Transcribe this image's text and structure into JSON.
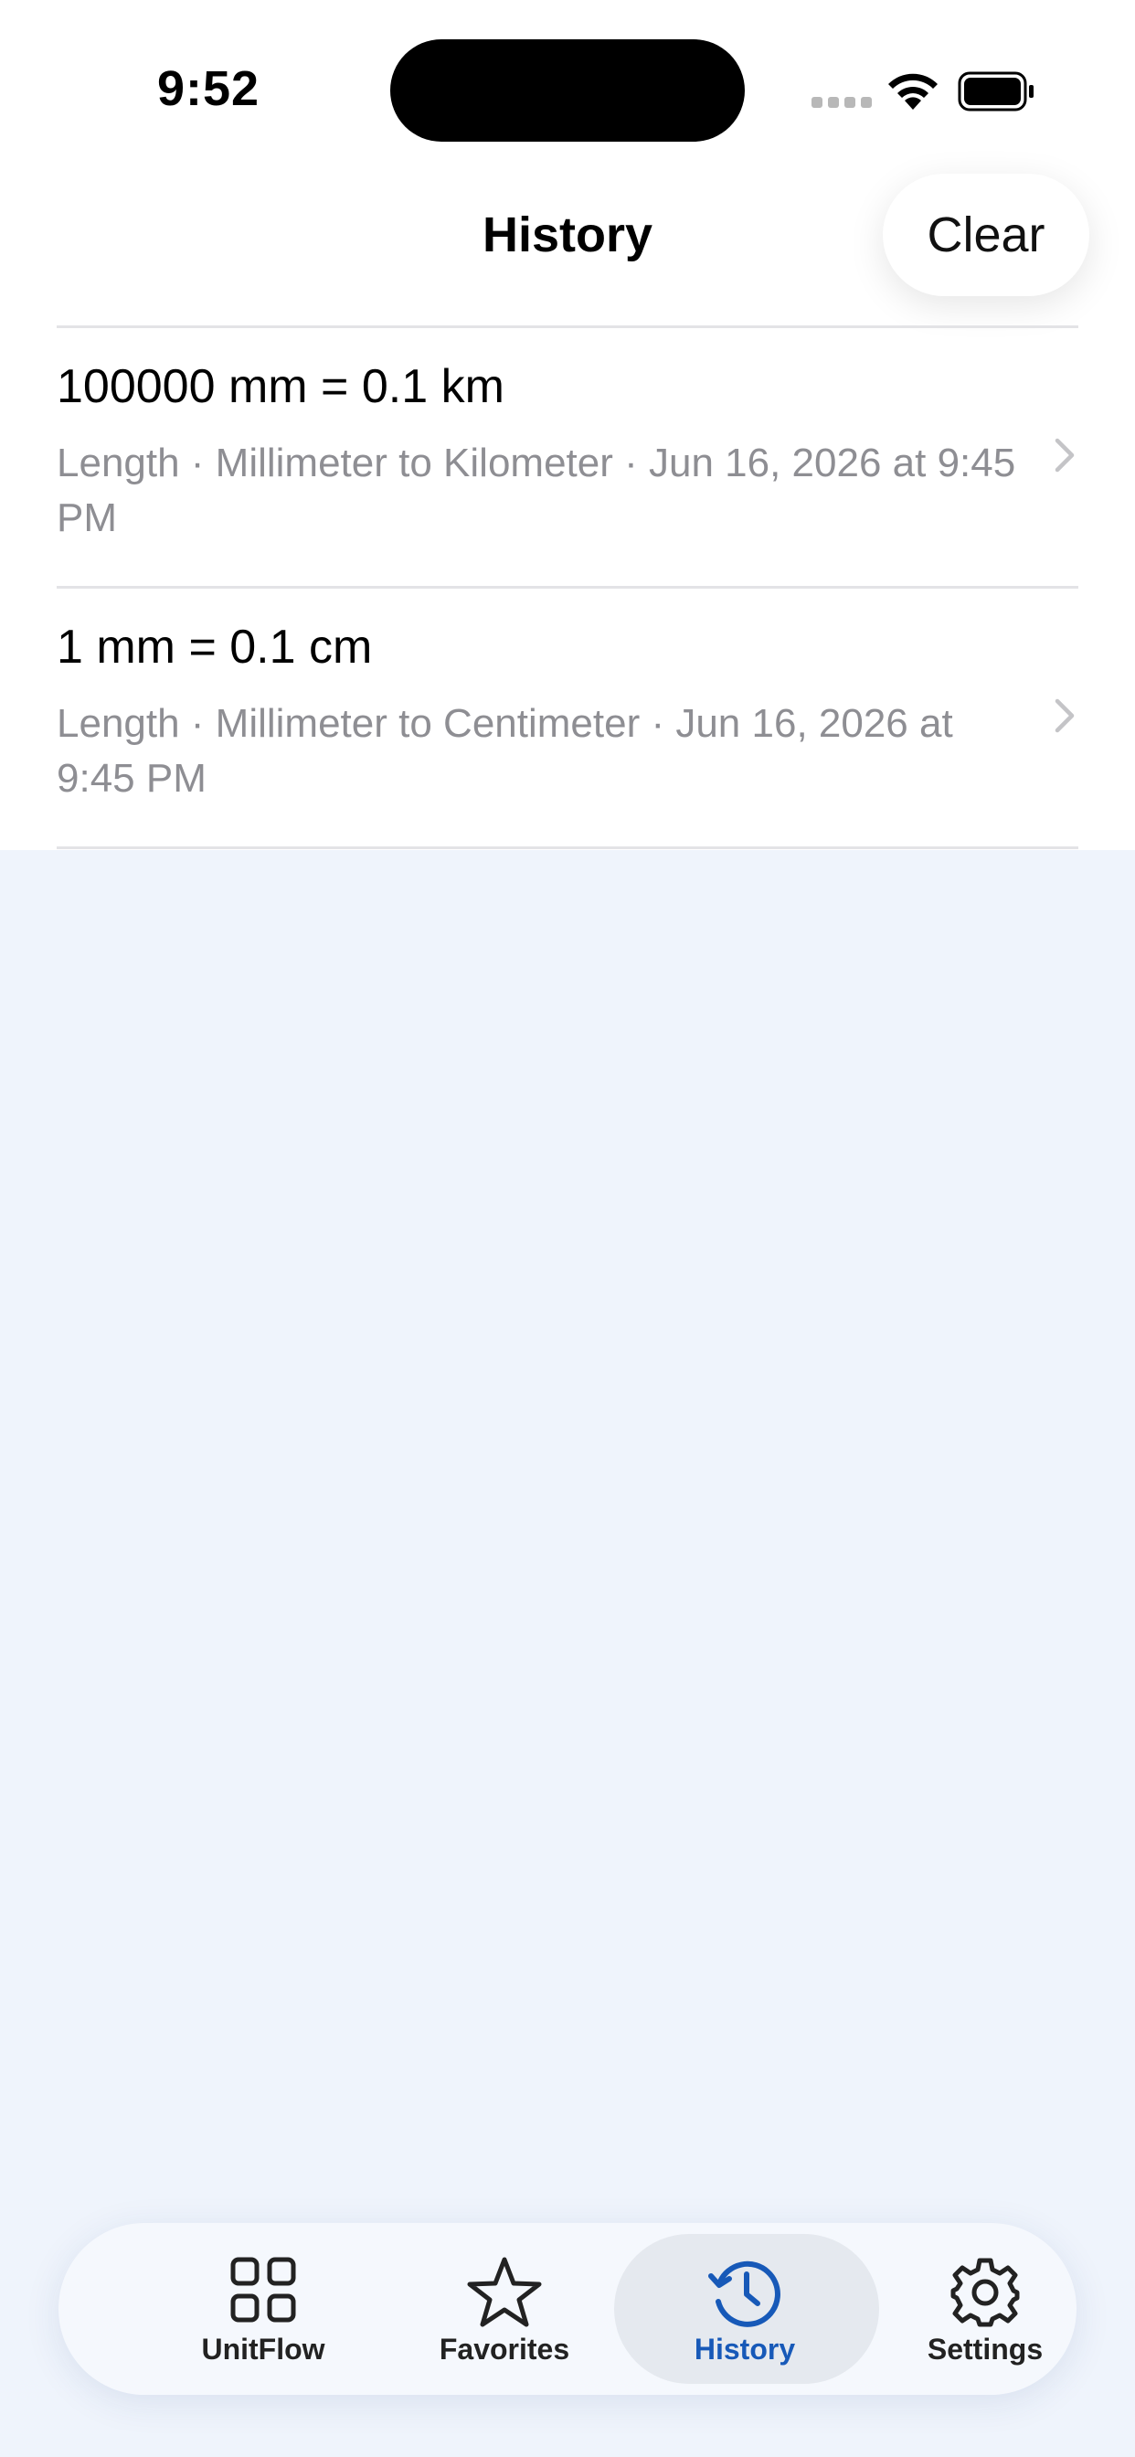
{
  "status_bar": {
    "time": "9:52"
  },
  "nav": {
    "title": "History",
    "clear_label": "Clear"
  },
  "history": [
    {
      "title": "100000 mm = 0.1 km",
      "subtitle": "Length · Millimeter to Kilometer · Jun 16, 2026 at 9:45 PM"
    },
    {
      "title": "1 mm = 0.1 cm",
      "subtitle": "Length · Millimeter to Centimeter · Jun 16, 2026 at 9:45 PM"
    }
  ],
  "tabs": [
    {
      "label": "UnitFlow",
      "icon": "grid-icon",
      "active": false
    },
    {
      "label": "Favorites",
      "icon": "star-icon",
      "active": false
    },
    {
      "label": "History",
      "icon": "history-clock-icon",
      "active": true
    },
    {
      "label": "Settings",
      "icon": "gear-icon",
      "active": false
    }
  ],
  "colors": {
    "accent": "#1759b8",
    "background": "#eff4fc",
    "secondary_text": "#8e8e93",
    "active_tab_pill": "#e5e9ef"
  }
}
